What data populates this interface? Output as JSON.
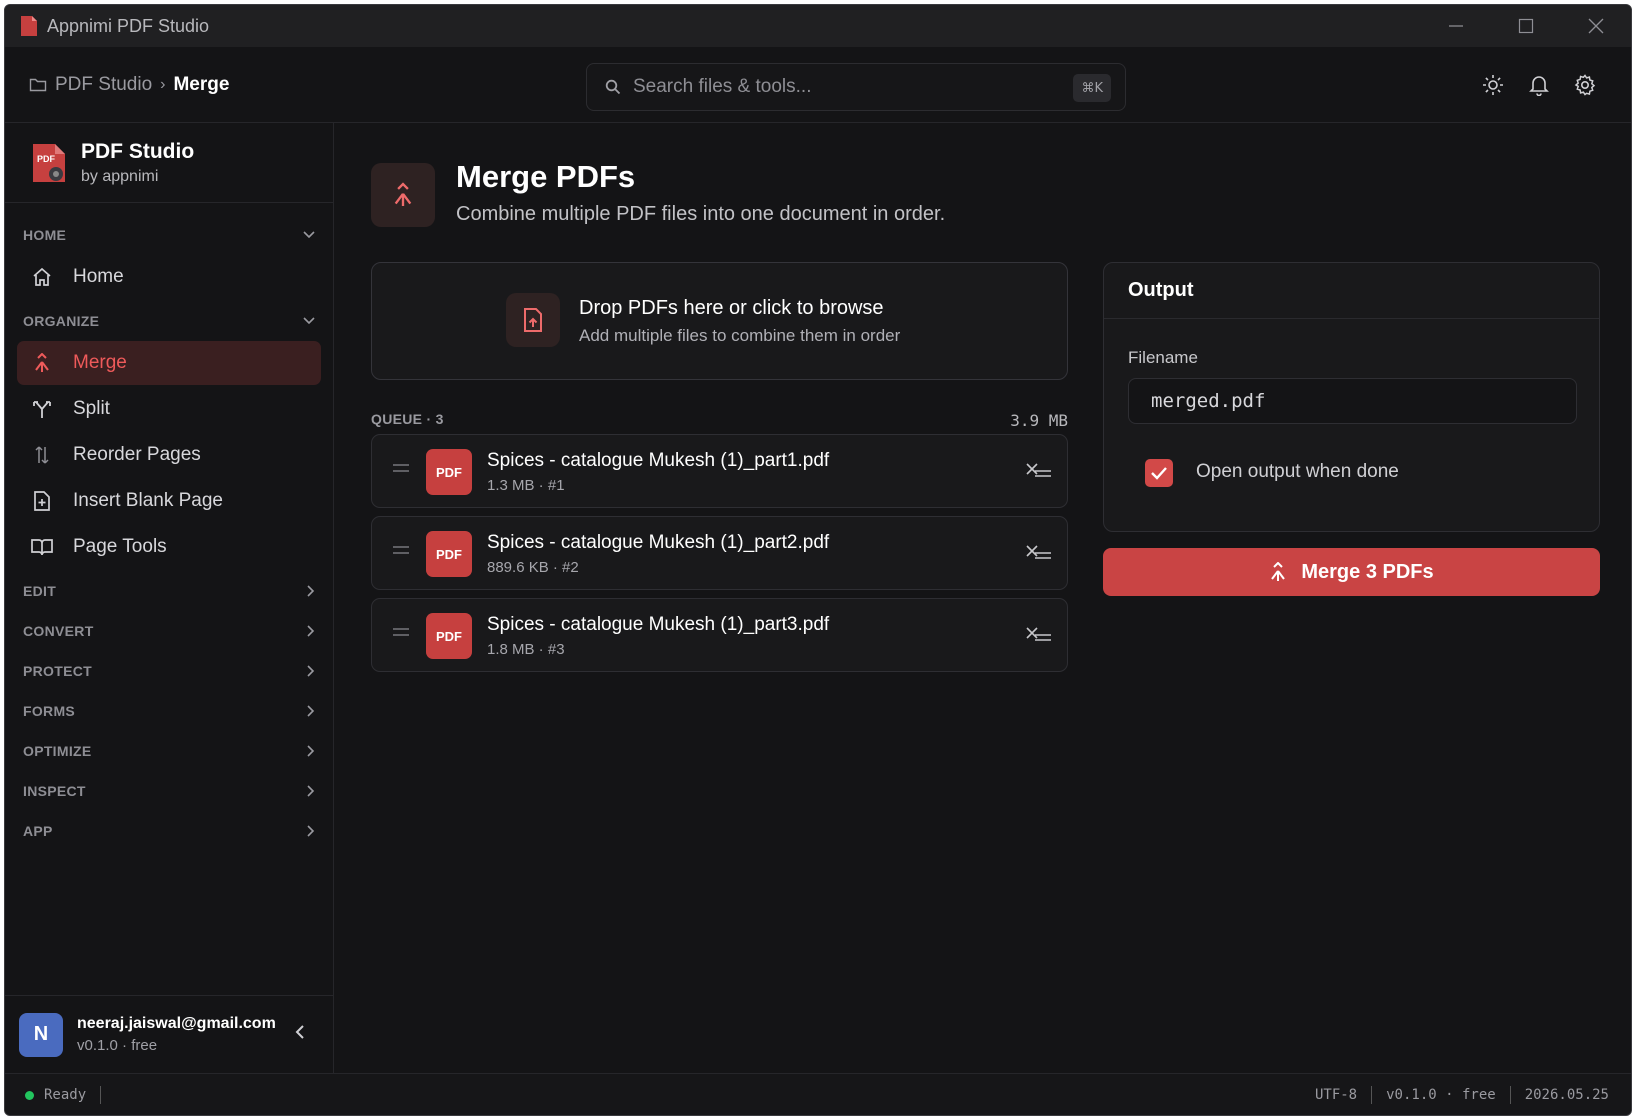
{
  "window": {
    "title": "Appnimi PDF Studio"
  },
  "breadcrumb": {
    "root": "PDF Studio",
    "current": "Merge"
  },
  "search": {
    "placeholder": "Search files & tools...",
    "shortcut": "⌘K"
  },
  "header_icons": [
    "sun-icon",
    "bell-icon",
    "gear-icon"
  ],
  "brand": {
    "name": "PDF Studio",
    "by": "by appnimi"
  },
  "sidebar": {
    "groups": [
      {
        "label": "HOME",
        "expanded": true,
        "items": [
          {
            "label": "Home",
            "icon": "home-icon"
          }
        ]
      },
      {
        "label": "ORGANIZE",
        "expanded": true,
        "items": [
          {
            "label": "Merge",
            "icon": "merge-icon",
            "active": true
          },
          {
            "label": "Split",
            "icon": "split-icon"
          },
          {
            "label": "Reorder Pages",
            "icon": "reorder-icon"
          },
          {
            "label": "Insert Blank Page",
            "icon": "file-plus-icon"
          },
          {
            "label": "Page Tools",
            "icon": "book-icon"
          }
        ]
      },
      {
        "label": "EDIT",
        "expanded": false
      },
      {
        "label": "CONVERT",
        "expanded": false
      },
      {
        "label": "PROTECT",
        "expanded": false
      },
      {
        "label": "FORMS",
        "expanded": false
      },
      {
        "label": "OPTIMIZE",
        "expanded": false
      },
      {
        "label": "INSPECT",
        "expanded": false
      },
      {
        "label": "APP",
        "expanded": false
      }
    ]
  },
  "user": {
    "initial": "N",
    "email": "neeraj.jaiswal@gmail.com",
    "meta": "v0.1.0 · free"
  },
  "page": {
    "title": "Merge PDFs",
    "subtitle": "Combine multiple PDF files into one document in order."
  },
  "dropzone": {
    "title": "Drop PDFs here or click to browse",
    "subtitle": "Add multiple files to combine them in order"
  },
  "queue": {
    "label": "QUEUE · 3",
    "total_size": "3.9 MB",
    "files": [
      {
        "badge": "PDF",
        "name": "Spices - catalogue Mukesh (1)_part1.pdf",
        "meta": "1.3 MB  ·  #1"
      },
      {
        "badge": "PDF",
        "name": "Spices - catalogue Mukesh (1)_part2.pdf",
        "meta": "889.6 KB  ·  #2"
      },
      {
        "badge": "PDF",
        "name": "Spices - catalogue Mukesh (1)_part3.pdf",
        "meta": "1.8 MB  ·  #3"
      }
    ]
  },
  "output": {
    "title": "Output",
    "filename_label": "Filename",
    "filename_value": "merged.pdf",
    "open_when_done_label": "Open output when done",
    "open_when_done": true
  },
  "merge_button": {
    "label": "Merge 3 PDFs"
  },
  "status": {
    "state": "Ready",
    "encoding": "UTF-8",
    "version": "v0.1.0 · free",
    "date": "2026.05.25"
  },
  "colors": {
    "accent": "#c94444",
    "accent_text": "#ee5a5a",
    "ready": "#22c55e"
  }
}
